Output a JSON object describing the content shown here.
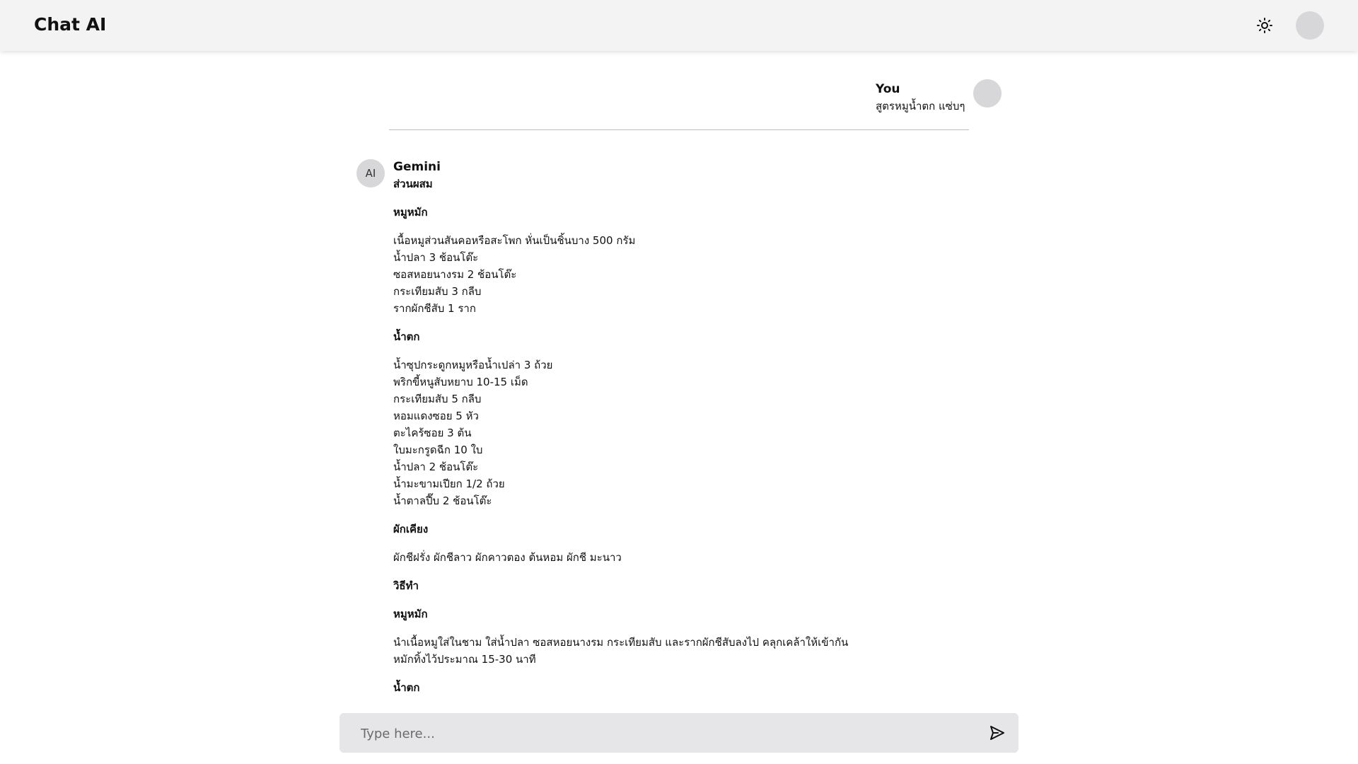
{
  "header": {
    "title": "Chat AI",
    "theme_icon": "sun-icon",
    "avatar_icon": "avatar"
  },
  "user_message": {
    "sender": "You",
    "text": "สูตรหมูน้ำตก แซ่บๆ"
  },
  "ai_message": {
    "avatar_label": "AI",
    "sender": "Gemini",
    "heading": "ส่วนผสม",
    "marinade": {
      "title": "หมูหมัก",
      "items": [
        "เนื้อหมูส่วนสันคอหรือสะโพก หั่นเป็นชิ้นบาง 500 กรัม",
        "น้ำปลา 3 ช้อนโต๊ะ",
        "ซอสหอยนางรม 2 ช้อนโต๊ะ",
        "กระเทียมสับ 3 กลีบ",
        "รากผักชีสับ 1 ราก"
      ]
    },
    "sauce": {
      "title": "น้ำตก",
      "items": [
        "น้ำซุปกระดูกหมูหรือน้ำเปล่า 3 ถ้วย",
        "พริกขี้หนูสับหยาบ 10-15 เม็ด",
        "กระเทียมสับ 5 กลีบ",
        "หอมแดงซอย 5 หัว",
        "ตะไคร้ซอย 3 ต้น",
        "ใบมะกรูดฉีก 10 ใบ",
        "น้ำปลา 2 ช้อนโต๊ะ",
        "น้ำมะขามเปียก 1/2 ถ้วย",
        "น้ำตาลปี๊บ 2 ช้อนโต๊ะ"
      ]
    },
    "sides": {
      "title": "ผักเคียง",
      "items": [
        "ผักชีฝรั่ง ผักชีลาว ผักคาวตอง ต้นหอม ผักชี มะนาว"
      ]
    },
    "method_heading": "วิธีทำ",
    "method_marinade": {
      "title": "หมูหมัก",
      "items": [
        "นำเนื้อหมูใส่ในชาม ใส่น้ำปลา ซอสหอยนางรม กระเทียมสับ และรากผักชีสับลงไป คลุกเคล้าให้เข้ากัน",
        "หมักทิ้งไว้ประมาณ 15-30 นาที"
      ]
    },
    "method_sauce_title": "น้ำตก"
  },
  "composer": {
    "placeholder": "Type here...",
    "value": "",
    "send_icon": "send-icon"
  }
}
